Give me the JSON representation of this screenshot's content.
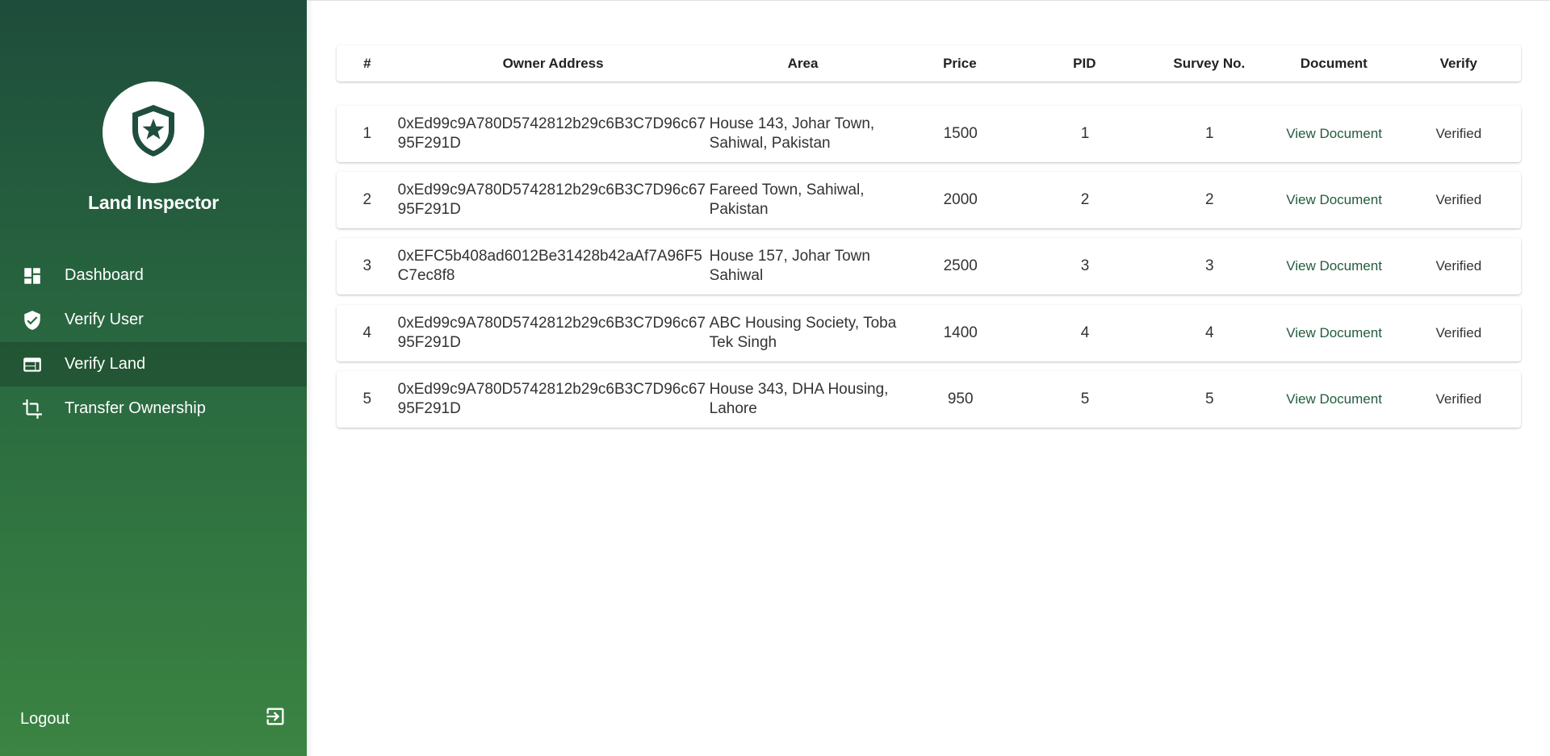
{
  "sidebar": {
    "brand": "Land Inspector",
    "avatar_icon": "shield-star-icon",
    "items": [
      {
        "label": "Dashboard",
        "icon": "dashboard-icon"
      },
      {
        "label": "Verify User",
        "icon": "verified-user-icon"
      },
      {
        "label": "Verify Land",
        "icon": "web-icon"
      },
      {
        "label": "Transfer Ownership",
        "icon": "crop-icon"
      }
    ],
    "active_item": "Verify Land",
    "logout_label": "Logout",
    "logout_icon": "logout-icon"
  },
  "table": {
    "headers": {
      "idx": "#",
      "owner": "Owner Address",
      "area": "Area",
      "price": "Price",
      "pid": "PID",
      "survey": "Survey No.",
      "document": "Document",
      "verify": "Verify"
    },
    "rows": [
      {
        "idx": "1",
        "owner": "0xEd99c9A780D5742812b29c6B3C7D96c6795F291D",
        "area": "House 143, Johar Town, Sahiwal, Pakistan",
        "price": "1500",
        "pid": "1",
        "survey": "1",
        "document": "View Document",
        "verify": "Verified"
      },
      {
        "idx": "2",
        "owner": "0xEd99c9A780D5742812b29c6B3C7D96c6795F291D",
        "area": "Fareed Town, Sahiwal, Pakistan",
        "price": "2000",
        "pid": "2",
        "survey": "2",
        "document": "View Document",
        "verify": "Verified"
      },
      {
        "idx": "3",
        "owner": "0xEFC5b408ad6012Be31428b42aAf7A96F5C7ec8f8",
        "area": "House 157, Johar Town Sahiwal",
        "price": "2500",
        "pid": "3",
        "survey": "3",
        "document": "View Document",
        "verify": "Verified"
      },
      {
        "idx": "4",
        "owner": "0xEd99c9A780D5742812b29c6B3C7D96c6795F291D",
        "area": "ABC Housing Society, Toba Tek Singh",
        "price": "1400",
        "pid": "4",
        "survey": "4",
        "document": "View Document",
        "verify": "Verified"
      },
      {
        "idx": "5",
        "owner": "0xEd99c9A780D5742812b29c6B3C7D96c6795F291D",
        "area": "House 343, DHA Housing, Lahore",
        "price": "950",
        "pid": "5",
        "survey": "5",
        "document": "View Document",
        "verify": "Verified"
      }
    ]
  },
  "colors": {
    "sidebar_top": "#1e4d3b",
    "sidebar_bottom": "#3b8442",
    "link": "#215c3d"
  }
}
